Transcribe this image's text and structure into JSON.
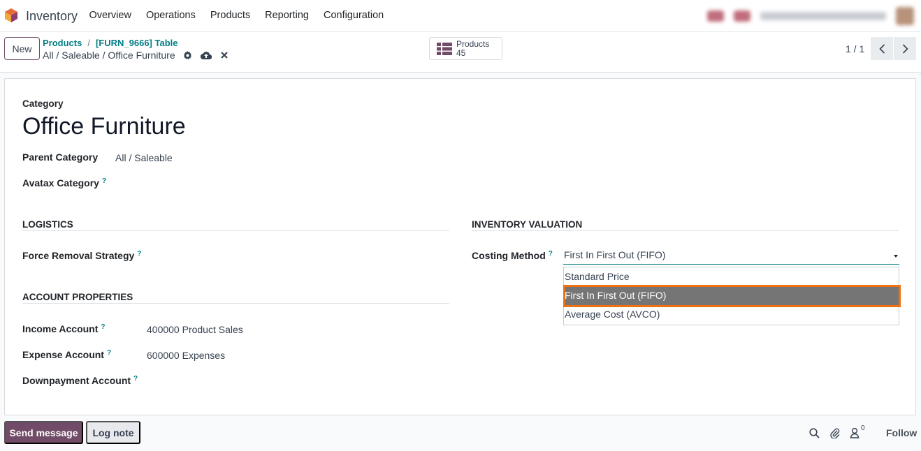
{
  "navbar": {
    "app_name": "Inventory",
    "menu": [
      "Overview",
      "Operations",
      "Products",
      "Reporting",
      "Configuration"
    ]
  },
  "control_panel": {
    "new_button": "New",
    "breadcrumb": [
      "Products",
      "[FURN_9666] Table"
    ],
    "breadcrumb_separator": "/",
    "current_record": "All / Saleable / Office Furniture",
    "smart_button": {
      "label": "Products",
      "count": "45"
    },
    "pager": "1 / 1"
  },
  "form": {
    "category_label": "Category",
    "title": "Office Furniture",
    "parent_category_label": "Parent Category",
    "parent_category_value": "All / Saleable",
    "avatax_label": "Avatax Category",
    "help_mark": "?",
    "logistics_header": "LOGISTICS",
    "force_removal_label": "Force Removal Strategy",
    "account_properties_header": "ACCOUNT PROPERTIES",
    "income_account_label": "Income Account",
    "income_account_value": "400000 Product Sales",
    "expense_account_label": "Expense Account",
    "expense_account_value": "600000 Expenses",
    "downpayment_label": "Downpayment Account",
    "inventory_valuation_header": "INVENTORY VALUATION",
    "costing_method_label": "Costing Method",
    "costing_method_value": "First In First Out (FIFO)",
    "costing_options": [
      "Standard Price",
      "First In First Out (FIFO)",
      "Average Cost (AVCO)"
    ],
    "selected_option_index": 1
  },
  "chatter": {
    "send_message": "Send message",
    "log_note": "Log note",
    "followers_count": "0",
    "follow": "Follow"
  },
  "colors": {
    "brand": "#714b67",
    "link": "#017e84",
    "highlight_border": "#f07012",
    "selected_option": "#757575"
  }
}
